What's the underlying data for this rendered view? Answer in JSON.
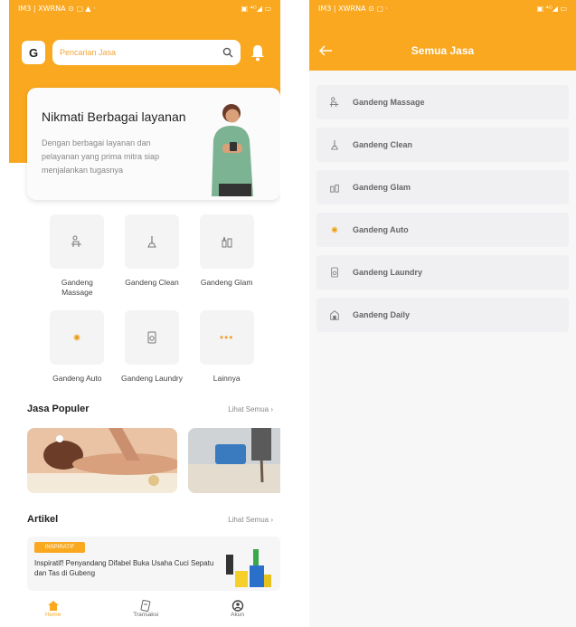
{
  "colors": {
    "brand": "#f9a81f",
    "background": "#ffffff"
  },
  "screen_home": {
    "status_left": "IM3 | XWRNA ⊙ ▢ ▲ ·",
    "status_right": "▣ ⁴ᴳ◢ ▭",
    "logo": "G",
    "search_placeholder": "Pencarian Jasa",
    "search_icon": "search-icon",
    "bell_icon": "bell-icon",
    "promo": {
      "title": "Nikmati Berbagai layanan",
      "text": "Dengan berbagai layanan dan pelayanan yang prima mitra siap menjalankan tugasnya"
    },
    "services": [
      {
        "label": "Gandeng Massage",
        "icon": "massage-icon"
      },
      {
        "label": "Gandeng Clean",
        "icon": "mop-icon"
      },
      {
        "label": "Gandeng Glam",
        "icon": "makeup-icon"
      },
      {
        "label": "Gandeng Auto",
        "icon": "car-icon"
      },
      {
        "label": "Gandeng Laundry",
        "icon": "laundry-icon"
      },
      {
        "label": "Lainnya",
        "icon": "more-icon"
      }
    ],
    "popular": {
      "title": "Jasa Populer",
      "more": "Lihat Semua ›"
    },
    "articles": {
      "title": "Artikel",
      "more": "Lihat Semua ›",
      "item": {
        "badge": "INSPIRATIF",
        "title": "Inspiratif! Penyandang Difabel Buka Usaha Cuci Sepatu dan Tas di Gubeng"
      }
    },
    "nav": [
      {
        "label": "Home",
        "icon": "home-icon"
      },
      {
        "label": "Transaksi",
        "icon": "transaction-icon"
      },
      {
        "label": "Akun",
        "icon": "account-icon"
      }
    ]
  },
  "screen_all": {
    "status_left": "IM3 | XWRNA ⊙ ▢ ·",
    "status_right": "▣ ⁴ᴳ◢ ▭",
    "back_icon": "arrow-left-icon",
    "title": "Semua Jasa",
    "items": [
      {
        "label": "Gandeng Massage",
        "icon": "massage-icon"
      },
      {
        "label": "Gandeng Clean",
        "icon": "mop-icon"
      },
      {
        "label": "Gandeng Glam",
        "icon": "makeup-icon"
      },
      {
        "label": "Gandeng Auto",
        "icon": "car-icon"
      },
      {
        "label": "Gandeng Laundry",
        "icon": "laundry-icon"
      },
      {
        "label": "Gandeng Daily",
        "icon": "daily-icon"
      }
    ]
  }
}
